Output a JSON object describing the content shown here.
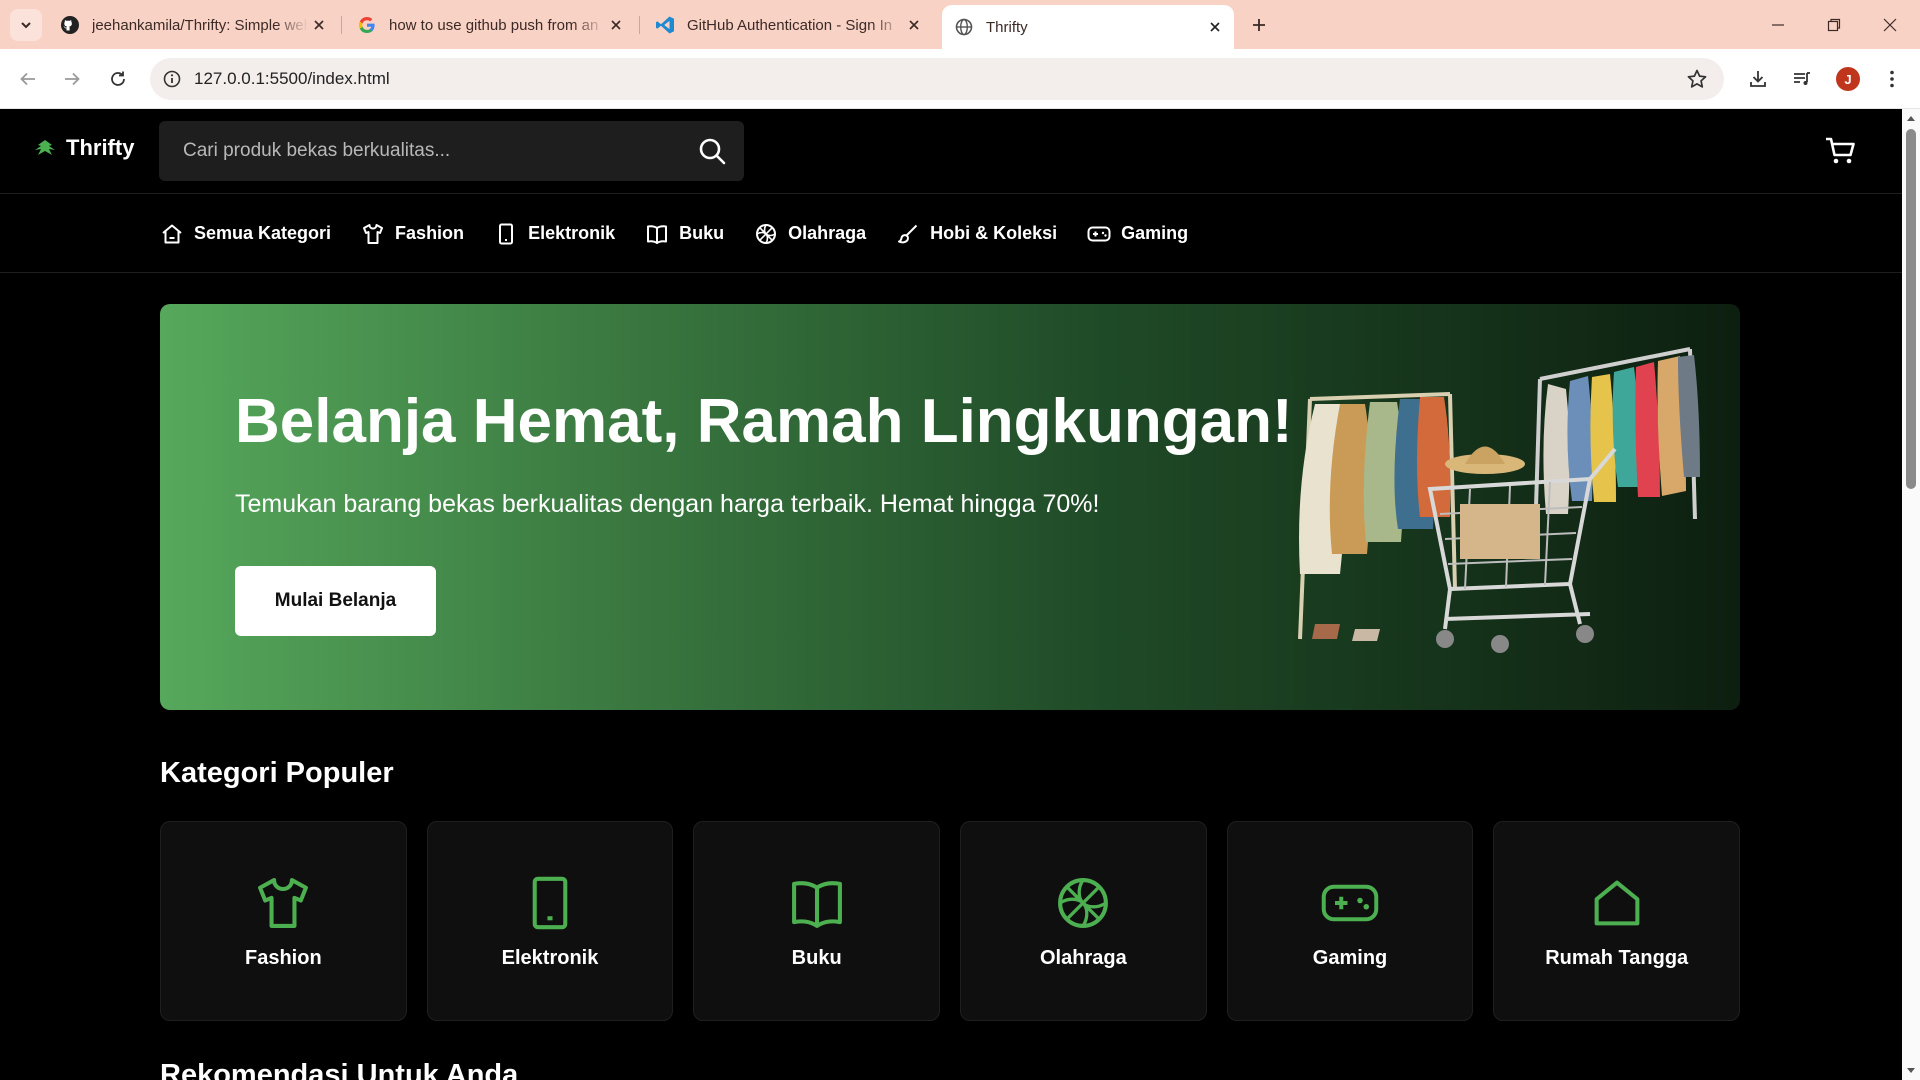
{
  "browser": {
    "tabs": [
      {
        "title": "jeehankamila/Thrifty: Simple web",
        "icon": "github-icon"
      },
      {
        "title": "how to use github push from an",
        "icon": "google-icon"
      },
      {
        "title": "GitHub Authentication - Sign In",
        "icon": "vscode-icon"
      },
      {
        "title": "Thrifty",
        "icon": "globe-icon",
        "active": true
      }
    ],
    "url": "127.0.0.1:5500/index.html",
    "profile_initial": "J",
    "colors": {
      "tab_strip": "#f9d2c6",
      "avatar": "#c0361d"
    }
  },
  "site": {
    "logo_text": "Thrifty",
    "search_placeholder": "Cari produk bekas berkualitas...",
    "accent": "#4caf50",
    "nav": [
      {
        "label": "Semua Kategori",
        "icon": "home-icon"
      },
      {
        "label": "Fashion",
        "icon": "shirt-icon"
      },
      {
        "label": "Elektronik",
        "icon": "smartphone-icon"
      },
      {
        "label": "Buku",
        "icon": "book-icon"
      },
      {
        "label": "Olahraga",
        "icon": "basketball-icon"
      },
      {
        "label": "Hobi & Koleksi",
        "icon": "brush-icon"
      },
      {
        "label": "Gaming",
        "icon": "gamepad-icon"
      }
    ],
    "hero": {
      "title": "Belanja Hemat, Ramah Lingkungan!",
      "subtitle": "Temukan barang bekas berkualitas dengan harga terbaik. Hemat hingga 70%!",
      "cta": "Mulai Belanja"
    },
    "popular": {
      "title": "Kategori Populer",
      "items": [
        {
          "label": "Fashion",
          "icon": "shirt-icon"
        },
        {
          "label": "Elektronik",
          "icon": "smartphone-icon"
        },
        {
          "label": "Buku",
          "icon": "book-icon"
        },
        {
          "label": "Olahraga",
          "icon": "basketball-icon"
        },
        {
          "label": "Gaming",
          "icon": "gamepad-icon"
        },
        {
          "label": "Rumah Tangga",
          "icon": "home-icon"
        }
      ]
    },
    "next_section_title": "Rekomendasi Untuk Anda"
  }
}
